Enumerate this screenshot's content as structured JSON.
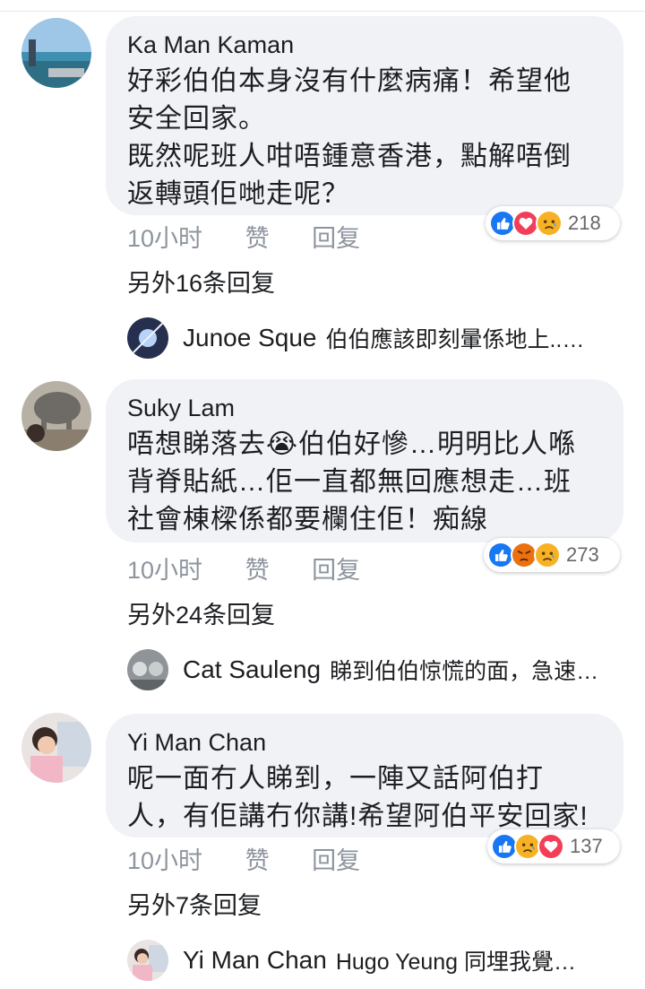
{
  "comments": [
    {
      "author": "Ka Man Kaman",
      "text": "好彩伯伯本身沒有什麼病痛！希望他\n安全回家。\n既然呢班人咁唔鍾意香港，點解唔倒\n返轉頭佢哋走呢？",
      "time": "10小时",
      "like": "赞",
      "reply": "回复",
      "reactions": [
        "like",
        "love",
        "sad"
      ],
      "reaction_count": "218",
      "more_replies": "另外16条回复",
      "reply_preview": {
        "author": "Junoe Sque",
        "text": "伯伯應該即刻暈係地上..…"
      }
    },
    {
      "author": "Suky Lam",
      "text": "唔想睇落去😭伯伯好慘…明明比人喺\n背脊貼紙…佢一直都無回應想走…班\n社會棟樑係都要欄住佢！痴線",
      "time": "10小时",
      "like": "赞",
      "reply": "回复",
      "reactions": [
        "like",
        "angry",
        "sad"
      ],
      "reaction_count": "273",
      "more_replies": "另外24条回复",
      "reply_preview": {
        "author": "Cat Sauleng",
        "text": "睇到伯伯惊慌的面，急速…"
      }
    },
    {
      "author": "Yi Man Chan",
      "text": "呢一面冇人睇到，一陣又話阿伯打\n人，有佢講冇你講!希望阿伯平安回家!",
      "time": "10小时",
      "like": "赞",
      "reply": "回复",
      "reactions": [
        "like",
        "sad",
        "love"
      ],
      "reaction_count": "137",
      "more_replies": "另外7条回复",
      "reply_preview": {
        "author": "Yi Man Chan",
        "text": "Hugo Yeung 同埋我覺…"
      }
    }
  ],
  "colors": {
    "like": "#1877f2",
    "love": "#f33e58",
    "sad": "#f7b125",
    "angry": "#e9710f",
    "bubble": "#f0f2f5",
    "meta": "#8d949e"
  }
}
